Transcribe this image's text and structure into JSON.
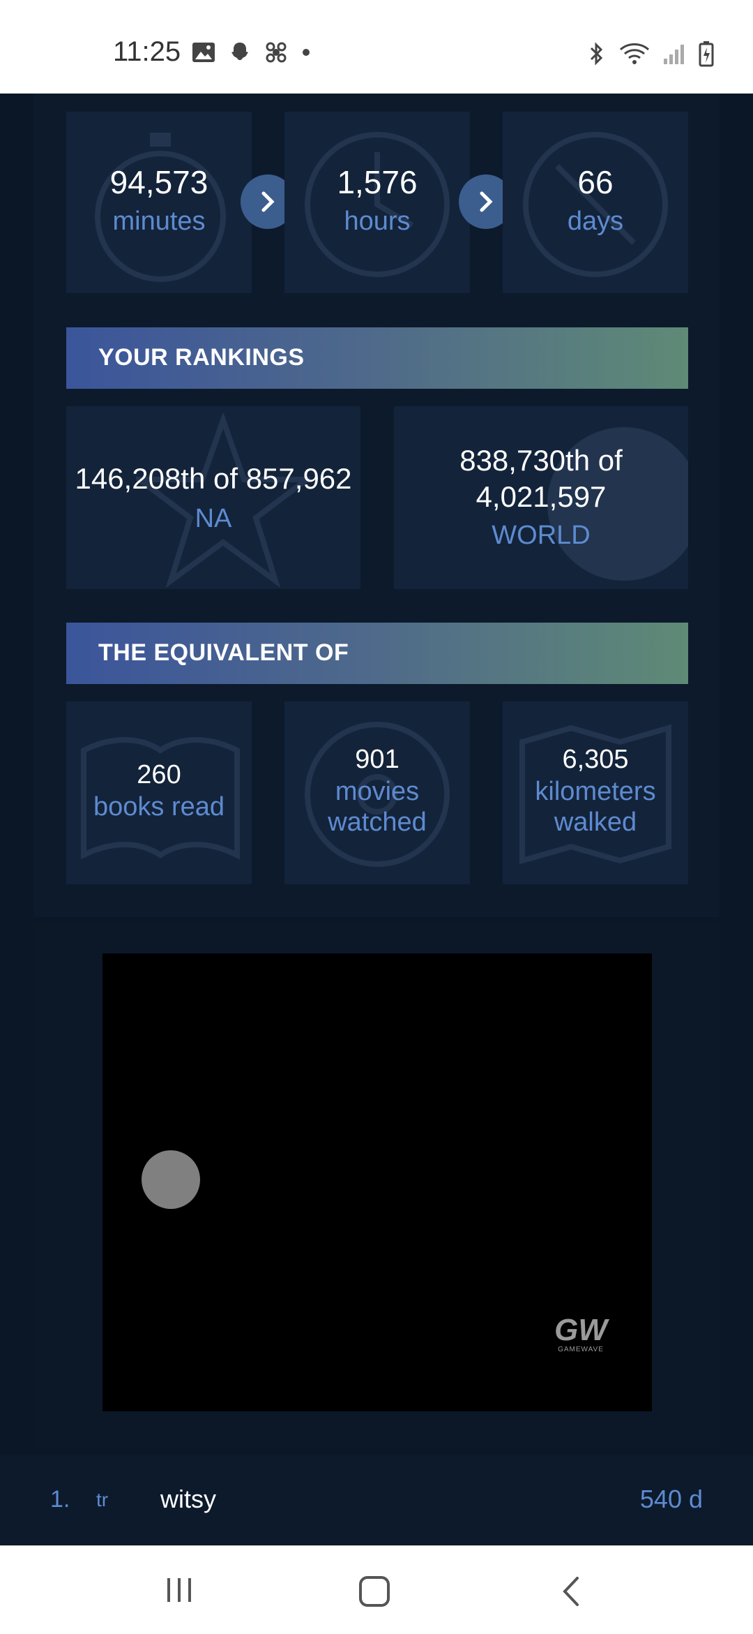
{
  "status_bar": {
    "time": "11:25"
  },
  "time_stats": [
    {
      "value": "94,573",
      "unit": "minutes"
    },
    {
      "value": "1,576",
      "unit": "hours"
    },
    {
      "value": "66",
      "unit": "days"
    }
  ],
  "rankings": {
    "header": "YOUR RANKINGS",
    "region": {
      "rank_line": "146,208th of 857,962",
      "label": "NA"
    },
    "world": {
      "rank_line1": "838,730th of",
      "rank_line2": "4,021,597",
      "label": "WORLD"
    }
  },
  "equivalent": {
    "header": "THE EQUIVALENT OF",
    "items": [
      {
        "value": "260",
        "label1": "books read",
        "label2": ""
      },
      {
        "value": "901",
        "label1": "movies",
        "label2": "watched"
      },
      {
        "value": "6,305",
        "label1": "kilometers",
        "label2": "walked"
      }
    ]
  },
  "video": {
    "watermark": "GW",
    "watermark_sub": "GAMEWAVE"
  },
  "leaderboard_row": {
    "rank": "1.",
    "flag": "tr",
    "name": "witsy",
    "value": "540 d"
  },
  "colors": {
    "accent": "#5e8bd0",
    "background": "#0b1626",
    "tile": "#13233a"
  }
}
